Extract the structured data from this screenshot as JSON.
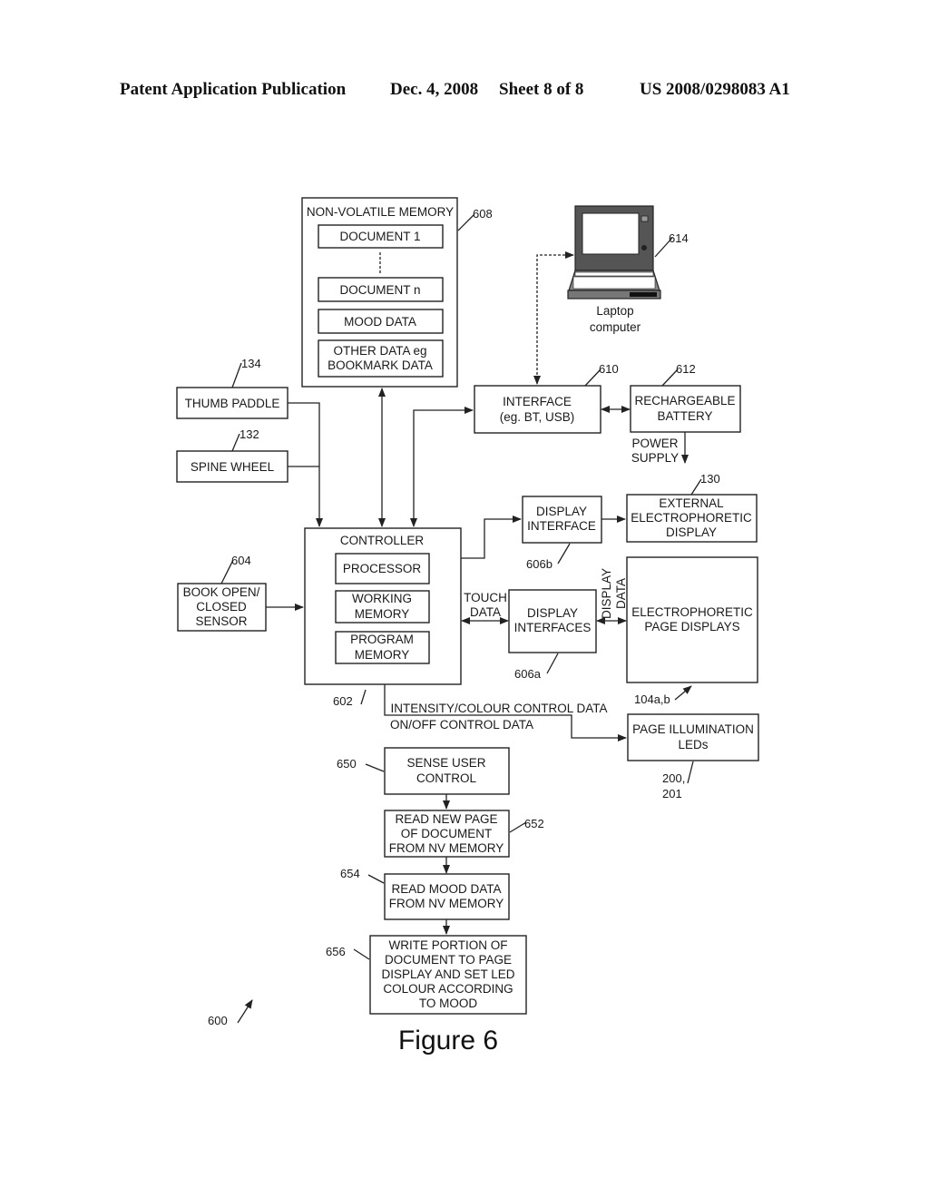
{
  "header": {
    "publication": "Patent Application Publication",
    "date": "Dec. 4, 2008",
    "sheet": "Sheet 8 of 8",
    "number": "US 2008/0298083 A1"
  },
  "figure_label": "Figure 6",
  "blocks": {
    "nv_memory": {
      "title": "NON-VOLATILE MEMORY",
      "ref": "608",
      "items": [
        "DOCUMENT 1",
        "DOCUMENT n",
        "MOOD DATA",
        [
          "OTHER DATA eg",
          "BOOKMARK DATA"
        ]
      ]
    },
    "laptop": {
      "lines": [
        "Laptop",
        "computer"
      ],
      "ref": "614"
    },
    "interface": {
      "lines": [
        "INTERFACE",
        "(eg. BT, USB)"
      ],
      "ref": "610"
    },
    "battery": {
      "lines": [
        "RECHARGEABLE",
        "BATTERY"
      ],
      "ref": "612",
      "output_label": [
        "POWER",
        "SUPPLY"
      ]
    },
    "thumb_paddle": {
      "label": "THUMB PADDLE",
      "ref": "134"
    },
    "spine_wheel": {
      "label": "SPINE WHEEL",
      "ref": "132"
    },
    "book_sensor": {
      "lines": [
        "BOOK OPEN/",
        "CLOSED",
        "SENSOR"
      ],
      "ref": "604"
    },
    "controller": {
      "title": "CONTROLLER",
      "ref": "602",
      "items": [
        [
          "PROCESSOR"
        ],
        [
          "WORKING",
          "MEMORY"
        ],
        [
          "PROGRAM",
          "MEMORY"
        ]
      ]
    },
    "display_interface_b": {
      "lines": [
        "DISPLAY",
        "INTERFACE"
      ],
      "ref": "606b"
    },
    "external_display": {
      "lines": [
        "EXTERNAL",
        "ELECTROPHORETIC",
        "DISPLAY"
      ],
      "ref": "130"
    },
    "display_interfaces_a": {
      "lines": [
        "DISPLAY",
        "INTERFACES"
      ],
      "ref": "606a"
    },
    "page_displays": {
      "lines": [
        "ELECTROPHORETIC",
        "PAGE DISPLAYS"
      ],
      "ref": "104a,b"
    },
    "leds": {
      "lines": [
        "PAGE ILLUMINATION",
        "LEDs"
      ],
      "ref": [
        "200,",
        "201"
      ]
    }
  },
  "edge_labels": {
    "touch_data": [
      "TOUCH",
      "DATA"
    ],
    "display_data": [
      "DISPLAY",
      "DATA"
    ],
    "intensity": "INTENSITY/COLOUR CONTROL DATA",
    "onoff": "ON/OFF CONTROL DATA"
  },
  "flow": [
    {
      "ref": "650",
      "lines": [
        "SENSE USER",
        "CONTROL"
      ]
    },
    {
      "ref": "652",
      "lines": [
        "READ NEW PAGE",
        "OF DOCUMENT",
        "FROM NV MEMORY"
      ]
    },
    {
      "ref": "654",
      "lines": [
        "READ MOOD DATA",
        "FROM NV MEMORY"
      ]
    },
    {
      "ref": "656",
      "lines": [
        "WRITE PORTION OF",
        "DOCUMENT TO PAGE",
        "DISPLAY AND SET LED",
        "COLOUR ACCORDING",
        "TO MOOD"
      ]
    }
  ],
  "overall_ref": "600"
}
